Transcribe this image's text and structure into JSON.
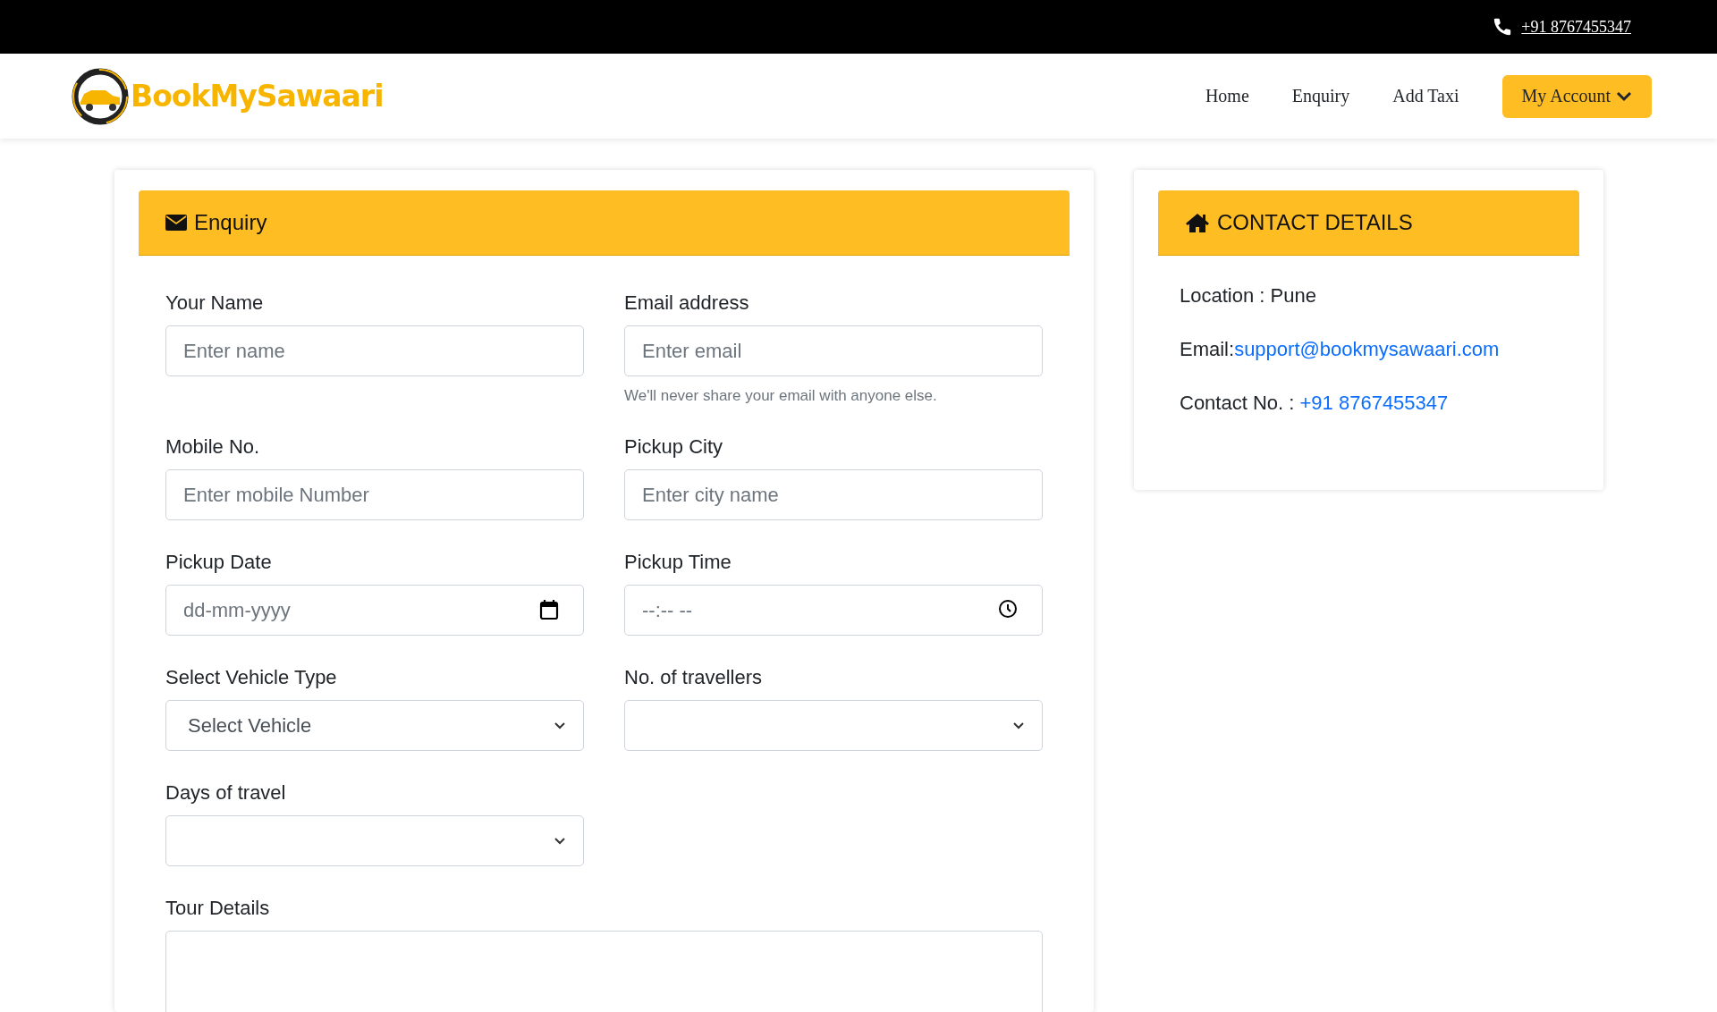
{
  "top_bar": {
    "phone": "+91 8767455347"
  },
  "navbar": {
    "logo_text": "BookMySawaari",
    "links": [
      {
        "label": "Home"
      },
      {
        "label": "Enquiry"
      },
      {
        "label": "Add Taxi"
      }
    ],
    "account_button": "My Account"
  },
  "enquiry": {
    "title": "Enquiry",
    "fields": [
      {
        "kind": "text",
        "label": "Your Name",
        "placeholder": "Enter name"
      },
      {
        "kind": "text",
        "label": "Email address",
        "placeholder": "Enter email",
        "help": "We'll never share your email with anyone else."
      },
      {
        "kind": "text",
        "label": "Mobile No.",
        "placeholder": "Enter mobile Number"
      },
      {
        "kind": "text",
        "label": "Pickup City",
        "placeholder": "Enter city name"
      },
      {
        "kind": "date",
        "label": "Pickup Date",
        "placeholder": "dd-mm-yyyy"
      },
      {
        "kind": "time",
        "label": "Pickup Time",
        "placeholder": "--:-- --"
      },
      {
        "kind": "select",
        "label": "Select Vehicle Type",
        "value": "Select Vehicle"
      },
      {
        "kind": "select",
        "label": "No. of travellers"
      },
      {
        "kind": "select",
        "label": "Days of travel"
      },
      {
        "kind": "textarea",
        "label": "Tour Details"
      }
    ]
  },
  "contact": {
    "title": "CONTACT DETAILS",
    "location": "Location : Pune",
    "email_label": "Email:",
    "email": "support@bookmysawaari.com",
    "phone_label": "Contact No. : ",
    "phone": "+91 8767455347"
  }
}
